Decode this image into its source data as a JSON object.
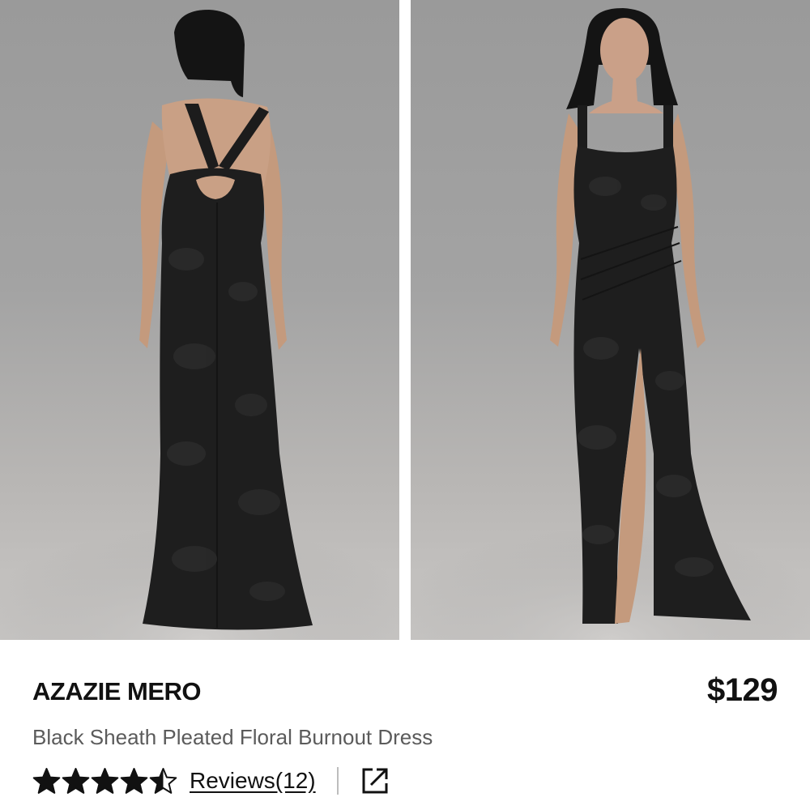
{
  "gallery": {
    "images": [
      {
        "name": "dress-back-view",
        "alt": ""
      },
      {
        "name": "dress-front-view",
        "alt": ""
      }
    ]
  },
  "product": {
    "brand": "AZAZIE MERO",
    "price": "$129",
    "name": "Black Sheath Pleated Floral Burnout Dress",
    "rating": 4.5,
    "rating_max": 5,
    "reviews_label": "Reviews(12)"
  },
  "icons": {
    "star": "star-icon",
    "share": "external-link-icon"
  },
  "colors": {
    "text": "#111111",
    "subtext": "#5b5b5b",
    "divider": "#bdbdbd",
    "dress": "#1e1e1e"
  }
}
